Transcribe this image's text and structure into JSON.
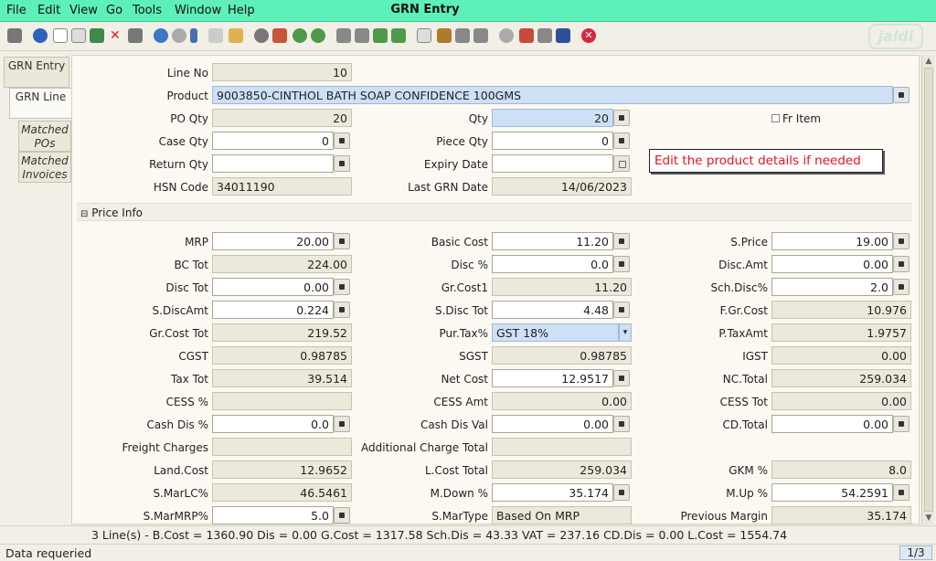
{
  "menu": [
    "File",
    "Edit",
    "View",
    "Go",
    "Tools",
    "Window",
    "Help"
  ],
  "app_title": "GRN Entry",
  "logo_text": "jaldi",
  "tabs": [
    "GRN Entry",
    "GRN Line",
    "Matched POs",
    "Matched Invoices"
  ],
  "line": {
    "line_no_label": "Line No",
    "line_no": "10",
    "product_label": "Product",
    "product": "9003850-CINTHOL BATH SOAP CONFIDENCE 100GMS",
    "po_qty_label": "PO Qty",
    "po_qty": "20",
    "qty_label": "Qty",
    "qty": "20",
    "fr_item_label": "Fr Item",
    "case_qty_label": "Case Qty",
    "case_qty": "0",
    "piece_qty_label": "Piece Qty",
    "piece_qty": "0",
    "return_qty_label": "Return Qty",
    "return_qty": "",
    "expiry_date_label": "Expiry Date",
    "expiry_date": "",
    "hsn_label": "HSN Code",
    "hsn": "34011190",
    "last_grn_label": "Last GRN Date",
    "last_grn": "14/06/2023"
  },
  "tooltip": "Edit the product details if needed",
  "section_title": "Price Info",
  "price": {
    "mrp_label": "MRP",
    "mrp": "20.00",
    "basic_cost_label": "Basic Cost",
    "basic_cost": "11.20",
    "s_price_label": "S.Price",
    "s_price": "19.00",
    "bc_tot_label": "BC Tot",
    "bc_tot": "224.00",
    "disc_pct_label": "Disc %",
    "disc_pct": "0.0",
    "disc_amt_label": "Disc.Amt",
    "disc_amt": "0.00",
    "disc_tot_label": "Disc Tot",
    "disc_tot": "0.00",
    "gr_cost1_label": "Gr.Cost1",
    "gr_cost1": "11.20",
    "sch_disc_label": "Sch.Disc%",
    "sch_disc": "2.0",
    "s_disc_amt_label": "S.DiscAmt",
    "s_disc_amt": "0.224",
    "s_disc_tot_label": "S.Disc Tot",
    "s_disc_tot": "4.48",
    "f_gr_cost_label": "F.Gr.Cost",
    "f_gr_cost": "10.976",
    "gr_cost_tot_label": "Gr.Cost Tot",
    "gr_cost_tot": "219.52",
    "pur_tax_label": "Pur.Tax%",
    "pur_tax": "GST 18%",
    "p_tax_amt_label": "P.TaxAmt",
    "p_tax_amt": "1.9757",
    "cgst_label": "CGST",
    "cgst": "0.98785",
    "sgst_label": "SGST",
    "sgst": "0.98785",
    "igst_label": "IGST",
    "igst": "0.00",
    "tax_tot_label": "Tax Tot",
    "tax_tot": "39.514",
    "net_cost_label": "Net Cost",
    "net_cost": "12.9517",
    "nc_total_label": "NC.Total",
    "nc_total": "259.034",
    "cess_pct_label": "CESS %",
    "cess_pct": "",
    "cess_amt_label": "CESS Amt",
    "cess_amt": "0.00",
    "cess_tot_label": "CESS Tot",
    "cess_tot": "0.00",
    "cash_dis_pct_label": "Cash Dis %",
    "cash_dis_pct": "0.0",
    "cash_dis_val_label": "Cash Dis Val",
    "cash_dis_val": "0.00",
    "cd_total_label": "CD.Total",
    "cd_total": "0.00",
    "freight_label": "Freight Charges",
    "freight": "",
    "add_charge_label": "Additional Charge Total",
    "add_charge": "",
    "land_cost_label": "Land.Cost",
    "land_cost": "12.9652",
    "l_cost_total_label": "L.Cost Total",
    "l_cost_total": "259.034",
    "gkm_label": "GKM %",
    "gkm": "8.0",
    "s_mar_lc_label": "S.MarLC%",
    "s_mar_lc": "46.5461",
    "m_down_label": "M.Down %",
    "m_down": "35.174",
    "m_up_label": "M.Up %",
    "m_up": "54.2591",
    "s_mar_mrp_label": "S.MarMRP%",
    "s_mar_mrp": "5.0",
    "s_mar_type_label": "S.MarType",
    "s_mar_type": "Based On MRP",
    "prev_margin_label": "Previous Margin",
    "prev_margin": "35.174"
  },
  "totals_line": "3 Line(s) -    B.Cost = 1360.90    Dis = 0.00    G.Cost = 1317.58    Sch.Dis = 43.33    VAT = 237.16    CD.Dis = 0.00    L.Cost = 1554.74",
  "status_text": "Data requeried",
  "pager": "1/3",
  "colors": {
    "menubar": "#5df0b8",
    "edit_field": "#ffffff",
    "readonly_field": "#ece9dc",
    "highlight_field": "#cde0f5",
    "tooltip_text": "#e8141b"
  }
}
